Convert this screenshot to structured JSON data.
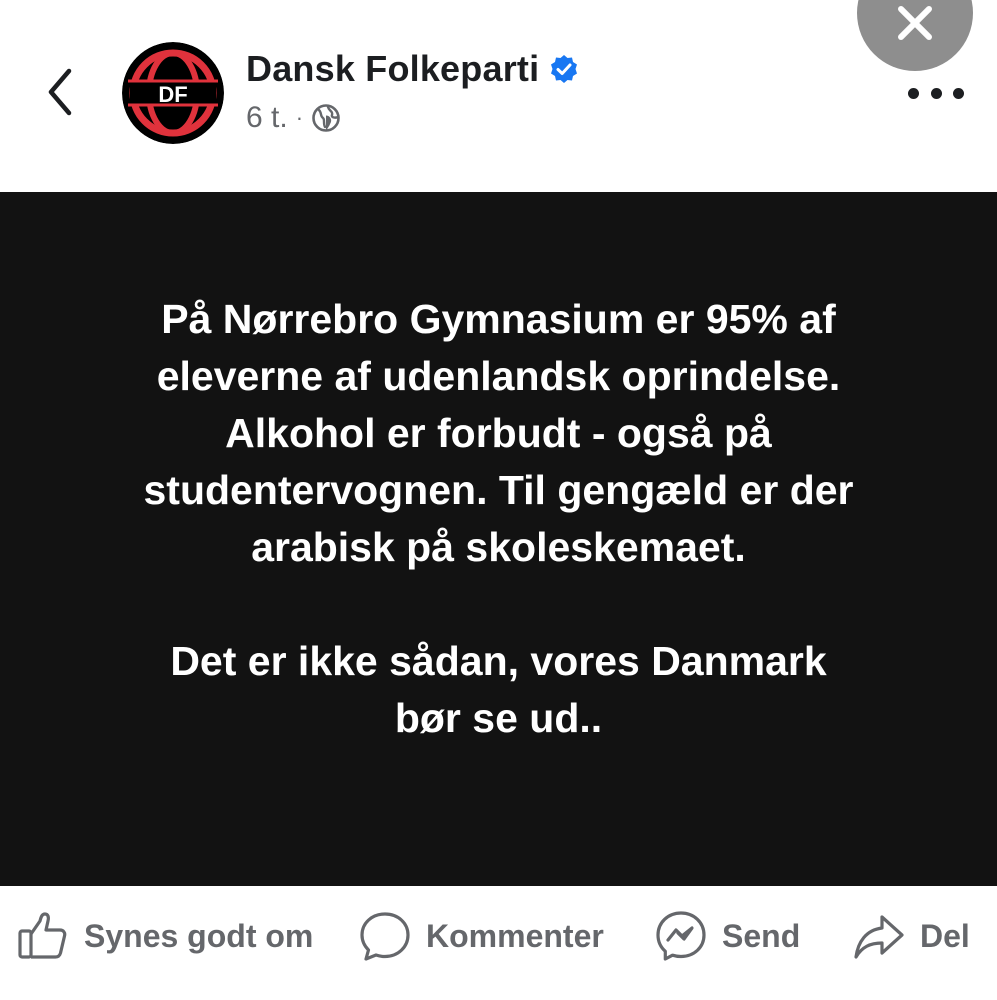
{
  "header": {
    "page_name": "Dansk Folkeparti",
    "avatar_text": "DF",
    "timestamp": "6 t.",
    "separator": "·",
    "visibility_icon": "globe-icon",
    "verified_icon": "verified-badge-icon",
    "back_icon": "chevron-left-icon",
    "close_icon": "close-icon",
    "more_icon": "more-horizontal-icon"
  },
  "post": {
    "paragraphs": [
      "På Nørrebro Gymnasium er 95% af eleverne af udenlandsk oprindelse. Alkohol er forbudt - også på studentervognen. Til gengæld er der arabisk på skoleskemaet.",
      "Det er ikke sådan, vores Danmark bør se ud.."
    ],
    "lines_1": [
      "På Nørrebro Gymnasium er 95% af",
      "eleverne af udenlandsk oprindelse.",
      "Alkohol er forbudt - også på",
      "studentervognen. Til gengæld er der",
      "arabisk på skoleskemaet."
    ],
    "lines_2": [
      "Det er ikke sådan, vores Danmark",
      "bør se ud.."
    ],
    "background_color": "#121212",
    "text_color": "#ffffff"
  },
  "actions": {
    "like": {
      "label": "Synes godt om",
      "icon": "thumbs-up-icon"
    },
    "comment": {
      "label": "Kommenter",
      "icon": "comment-bubble-icon"
    },
    "send": {
      "label": "Send",
      "icon": "messenger-icon"
    },
    "share": {
      "label": "Del",
      "icon": "share-arrow-icon"
    }
  },
  "colors": {
    "verified_blue": "#1877f2",
    "secondary_text": "#65676b",
    "primary_text": "#1c1e21",
    "logo_red": "#e0323c"
  }
}
